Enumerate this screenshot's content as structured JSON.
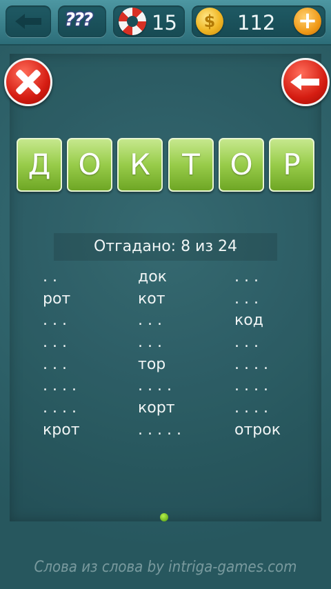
{
  "topbar": {
    "hint_symbol": "???",
    "lives": "15",
    "coin_symbol": "$",
    "coins": "112",
    "plus_symbol": "+"
  },
  "word": {
    "letters": [
      "Д",
      "О",
      "К",
      "Т",
      "О",
      "Р"
    ]
  },
  "progress": {
    "text": "Отгадано: 8 из 24"
  },
  "words": {
    "col1": [
      ". .",
      "рот",
      ". . .",
      ". . .",
      ". . .",
      ". . . .",
      ". . . .",
      "крот"
    ],
    "col2": [
      "док",
      "кот",
      ". . .",
      ". . .",
      "тор",
      ". . . .",
      "корт",
      ". . . . ."
    ],
    "col3": [
      ". . .",
      ". . .",
      "код",
      ". . .",
      ". . . .",
      ". . . .",
      ". . . .",
      "отрок"
    ]
  },
  "footer": {
    "text": "Слова из слова by intriga-games.com"
  },
  "colors": {
    "background": "#2f6a73",
    "tile_green": "#98cc4a",
    "button_red": "#d51d12",
    "coin_gold": "#f0b624"
  },
  "icons": [
    "back-arrow-icon",
    "hint-question-icon",
    "lifebuoy-icon",
    "coin-icon",
    "plus-icon",
    "close-icon",
    "undo-arrow-icon"
  ]
}
